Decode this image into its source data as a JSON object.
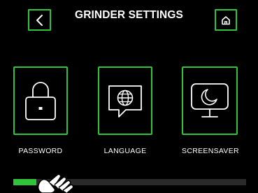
{
  "header": {
    "title": "GRINDER SETTINGS",
    "back_icon": "chevron-left-icon",
    "home_icon": "home-icon"
  },
  "tiles": [
    {
      "label": "PASSWORD",
      "icon": "lock-icon"
    },
    {
      "label": "LANGUAGE",
      "icon": "globe-chat-icon"
    },
    {
      "label": "SCREENSAVER",
      "icon": "moon-monitor-icon"
    }
  ],
  "scrollbar": {
    "position": 0.1
  },
  "colors": {
    "accent": "#2fc43a",
    "background": "#000000",
    "text": "#ffffff",
    "track": "#2a2a2a"
  }
}
